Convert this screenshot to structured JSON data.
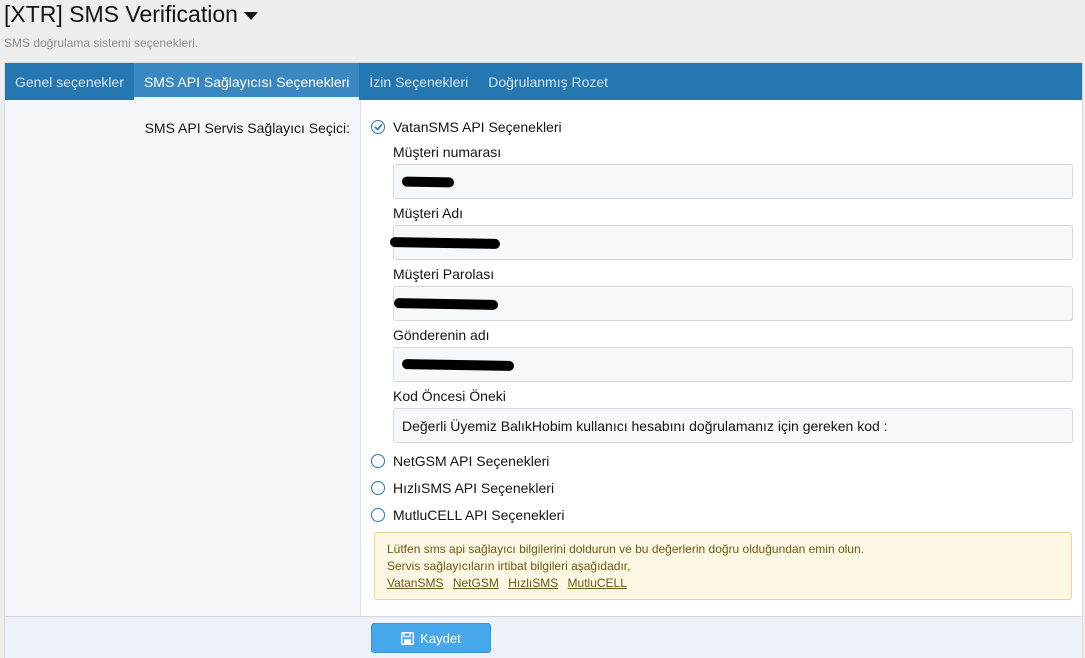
{
  "header": {
    "title": "[XTR] SMS Verification",
    "description": "SMS doğrulama sistemi seçenekleri."
  },
  "tabs": [
    {
      "label": "Genel seçenekler",
      "active": false
    },
    {
      "label": "SMS API Sağlayıcısı Seçenekleri",
      "active": true
    },
    {
      "label": "İzin Seçenekleri",
      "active": false
    },
    {
      "label": "Doğrulanmış Rozet",
      "active": false
    }
  ],
  "form": {
    "row_label": "SMS API Servis Sağlayıcı Seçici:",
    "providers": [
      {
        "label": "VatanSMS API Seçenekleri",
        "selected": true
      },
      {
        "label": "NetGSM API Seçenekleri",
        "selected": false
      },
      {
        "label": "HızlıSMS API Seçenekleri",
        "selected": false
      },
      {
        "label": "MutluCELL API Seçenekleri",
        "selected": false
      }
    ],
    "fields": [
      {
        "label": "Müşteri numarası",
        "value": "",
        "redacted": true
      },
      {
        "label": "Müşteri Adı",
        "value": "",
        "redacted": true
      },
      {
        "label": "Müşteri Parolası",
        "value": "",
        "redacted": true
      },
      {
        "label": "Gönderenin adı",
        "value": "",
        "redacted": true
      },
      {
        "label": "Kod Öncesi Öneki",
        "value": "Değerli Üyemiz BalıkHobim kullanıcı hesabını doğrulamanız için gereken kod :",
        "redacted": false
      }
    ],
    "notice": {
      "line1": "Lütfen sms api sağlayıcı bilgilerini doldurun ve bu değerlerin doğru olduğundan emin olun.",
      "line2": "Servis sağlayıcıların irtibat bilgileri aşağıdadır,",
      "links": [
        "VatanSMS",
        "NetGSM",
        "HızlıSMS",
        "MutluCELL"
      ]
    }
  },
  "footer": {
    "save_label": "Kaydet"
  },
  "colors": {
    "tab_bar": "#2577b1",
    "button": "#47a7eb",
    "notice_bg": "#fdf8e3"
  }
}
